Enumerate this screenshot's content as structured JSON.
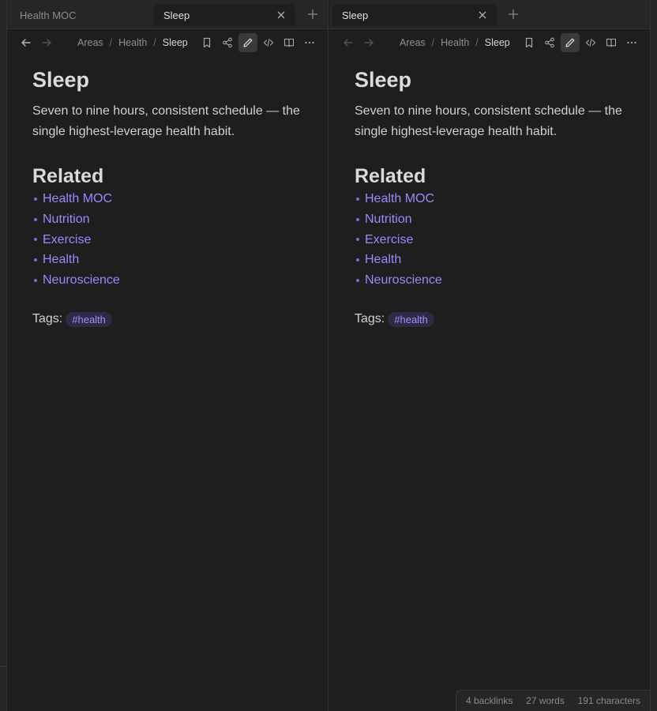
{
  "left_pane": {
    "tabs": [
      {
        "label": "Health MOC",
        "active": false
      },
      {
        "label": "Sleep",
        "active": true
      }
    ],
    "breadcrumb": [
      "Areas",
      "Health",
      "Sleep"
    ],
    "breadcrumb_sep": "/",
    "note": {
      "title": "Sleep",
      "paragraph": "Seven to nine hours, consistent schedule — the single highest-leverage health habit.",
      "related_heading": "Related",
      "related": [
        "Health MOC",
        "Nutrition",
        "Exercise",
        "Health",
        "Neuroscience"
      ],
      "tags_label": "Tags:",
      "tag": "#health"
    }
  },
  "right_pane": {
    "tabs": [
      {
        "label": "Sleep",
        "active": true
      }
    ],
    "breadcrumb": [
      "Areas",
      "Health",
      "Sleep"
    ],
    "breadcrumb_sep": "/",
    "note": {
      "title": "Sleep",
      "paragraph": "Seven to nine hours, consistent schedule — the single highest-leverage health habit.",
      "related_heading": "Related",
      "related": [
        "Health MOC",
        "Nutrition",
        "Exercise",
        "Health",
        "Neuroscience"
      ],
      "tags_label": "Tags:",
      "tag": "#health"
    }
  },
  "status_bar": {
    "backlinks": "4 backlinks",
    "words": "27 words",
    "characters": "191 characters"
  },
  "icons": {
    "close": "close-icon",
    "new_tab": "plus-icon",
    "back": "arrow-left-icon",
    "forward": "arrow-right-icon",
    "bookmark": "bookmark-icon",
    "share": "share-icon",
    "edit": "pencil-icon",
    "source": "code-icon",
    "reading": "book-open-icon",
    "more": "more-horizontal-icon"
  },
  "colors": {
    "background": "#1e1e1e",
    "link": "#9b89ff",
    "tag_bg": "#2e2a43",
    "tag_text": "#a48dff"
  }
}
